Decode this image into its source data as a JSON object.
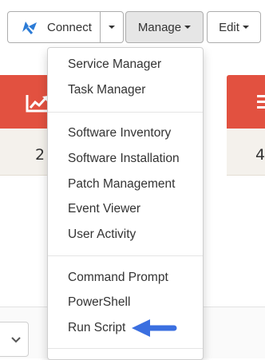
{
  "toolbar": {
    "connect_label": "Connect",
    "manage_label": "Manage",
    "edit_label": "Edit"
  },
  "tiles": {
    "left_value": "2",
    "right_value": "4"
  },
  "manage_menu": {
    "items": [
      "Service Manager",
      "Task Manager",
      "Software Inventory",
      "Software Installation",
      "Patch Management",
      "Event Viewer",
      "User Activity",
      "Command Prompt",
      "PowerShell",
      "Run Script"
    ],
    "highlighted_item": "Run Script"
  },
  "colors": {
    "tile_red": "#e25140",
    "tile_body": "#f4f1ec",
    "arrow_blue": "#3b6fe0"
  },
  "icons": {
    "connect": "connect-icon",
    "chart": "chart-trend-icon",
    "list": "list-icon"
  }
}
